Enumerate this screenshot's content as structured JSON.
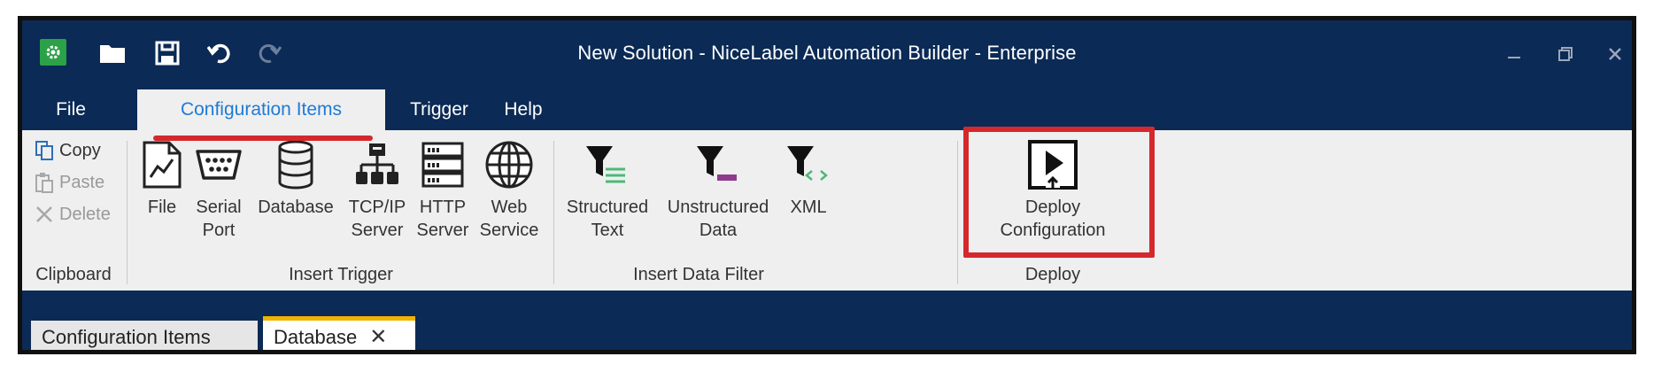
{
  "window": {
    "title": "New Solution - NiceLabel Automation Builder - Enterprise",
    "controls": [
      "minimize",
      "restore",
      "close"
    ]
  },
  "quick_access": {
    "icons": [
      "app-gear-icon",
      "open-folder-icon",
      "save-icon",
      "undo-icon",
      "redo-icon"
    ]
  },
  "menu": {
    "tabs": [
      {
        "label": "File"
      },
      {
        "label": "Configuration Items",
        "active": true
      },
      {
        "label": "Trigger"
      },
      {
        "label": "Help"
      }
    ]
  },
  "ribbon": {
    "clipboard": {
      "label": "Clipboard",
      "items": [
        {
          "label": "Copy",
          "enabled": true
        },
        {
          "label": "Paste",
          "enabled": false
        },
        {
          "label": "Delete",
          "enabled": false
        }
      ]
    },
    "insert_trigger": {
      "label": "Insert Trigger",
      "buttons": [
        {
          "label": "File"
        },
        {
          "label": "Serial\nPort"
        },
        {
          "label": "Database"
        },
        {
          "label": "TCP/IP\nServer"
        },
        {
          "label": "HTTP\nServer"
        },
        {
          "label": "Web\nService"
        }
      ]
    },
    "insert_data_filter": {
      "label": "Insert Data Filter",
      "buttons": [
        {
          "label": "Structured\nText"
        },
        {
          "label": "Unstructured\nData"
        },
        {
          "label": "XML"
        }
      ]
    },
    "deploy": {
      "label": "Deploy",
      "buttons": [
        {
          "label": "Deploy\nConfiguration"
        }
      ]
    }
  },
  "document_tabs": [
    {
      "label": "Configuration Items",
      "active": false
    },
    {
      "label": "Database",
      "active": true,
      "closable": true
    }
  ],
  "colors": {
    "titlebar": "#0b2a55",
    "ribbon": "#efefef",
    "accent_text": "#1e7bd6",
    "highlight": "#d5282c",
    "active_doc_tab": "#f0b400",
    "app_icon": "#2ba148"
  }
}
